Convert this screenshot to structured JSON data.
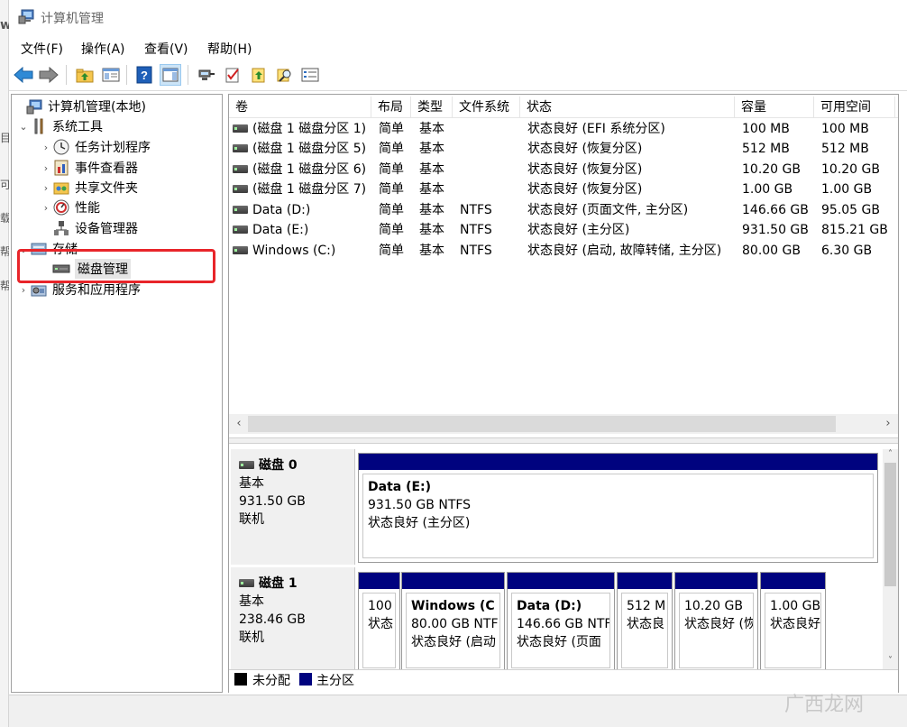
{
  "window": {
    "title": "计算机管理"
  },
  "background_window": {
    "chars": [
      "w",
      "目",
      "可",
      "载",
      "帮",
      "帮"
    ]
  },
  "menu": [
    "文件(F)",
    "操作(A)",
    "查看(V)",
    "帮助(H)"
  ],
  "toolbar": [
    "back-icon",
    "forward-icon",
    "up-folder-icon",
    "show-hide-tree-icon",
    "help-icon",
    "properties-pane-icon",
    "connect-icon",
    "check-icon",
    "export-icon",
    "find-icon",
    "list-icon"
  ],
  "tree": {
    "items": [
      {
        "label": "计算机管理(本地)",
        "expander": ""
      },
      {
        "label": "系统工具",
        "expander": "⌄"
      },
      {
        "label": "任务计划程序",
        "expander": "›"
      },
      {
        "label": "事件查看器",
        "expander": "›"
      },
      {
        "label": "共享文件夹",
        "expander": "›"
      },
      {
        "label": "性能",
        "expander": "›"
      },
      {
        "label": "设备管理器",
        "expander": ""
      },
      {
        "label": "存储",
        "expander": "⌄"
      },
      {
        "label": "磁盘管理",
        "expander": ""
      },
      {
        "label": "服务和应用程序",
        "expander": "›"
      }
    ]
  },
  "volume_table": {
    "headers": [
      "卷",
      "布局",
      "类型",
      "文件系统",
      "状态",
      "容量",
      "可用空间"
    ],
    "rows": [
      [
        "(磁盘 1 磁盘分区 1)",
        "简单",
        "基本",
        "",
        "状态良好 (EFI 系统分区)",
        "100 MB",
        "100 MB"
      ],
      [
        "(磁盘 1 磁盘分区 5)",
        "简单",
        "基本",
        "",
        "状态良好 (恢复分区)",
        "512 MB",
        "512 MB"
      ],
      [
        "(磁盘 1 磁盘分区 6)",
        "简单",
        "基本",
        "",
        "状态良好 (恢复分区)",
        "10.20 GB",
        "10.20 GB"
      ],
      [
        "(磁盘 1 磁盘分区 7)",
        "简单",
        "基本",
        "",
        "状态良好 (恢复分区)",
        "1.00 GB",
        "1.00 GB"
      ],
      [
        "Data (D:)",
        "简单",
        "基本",
        "NTFS",
        "状态良好 (页面文件, 主分区)",
        "146.66 GB",
        "95.05 GB"
      ],
      [
        "Data (E:)",
        "简单",
        "基本",
        "NTFS",
        "状态良好 (主分区)",
        "931.50 GB",
        "815.21 GB"
      ],
      [
        "Windows (C:)",
        "简单",
        "基本",
        "NTFS",
        "状态良好 (启动, 故障转储, 主分区)",
        "80.00 GB",
        "6.30 GB"
      ]
    ]
  },
  "disks": [
    {
      "name": "磁盘 0",
      "type": "基本",
      "size": "931.50 GB",
      "status": "联机",
      "partitions": [
        {
          "title": "Data  (E:)",
          "line2": "931.50 GB NTFS",
          "line3": "状态良好 (主分区)"
        }
      ]
    },
    {
      "name": "磁盘 1",
      "type": "基本",
      "size": "238.46 GB",
      "status": "联机",
      "partitions": [
        {
          "title": "",
          "line2": "100",
          "line3": "状态"
        },
        {
          "title": "Windows  (C",
          "line2": "80.00 GB NTF",
          "line3": "状态良好 (启动"
        },
        {
          "title": "Data  (D:)",
          "line2": "146.66 GB NTF",
          "line3": "状态良好 (页面"
        },
        {
          "title": "",
          "line2": "512 M",
          "line3": "状态良"
        },
        {
          "title": "",
          "line2": "10.20 GB",
          "line3": "状态良好 (恢"
        },
        {
          "title": "",
          "line2": "1.00 GB",
          "line3": "状态良好"
        }
      ]
    }
  ],
  "legend": [
    {
      "label": "未分配",
      "color": "#000000"
    },
    {
      "label": "主分区",
      "color": "#00037f"
    }
  ],
  "watermark": "广西龙网"
}
